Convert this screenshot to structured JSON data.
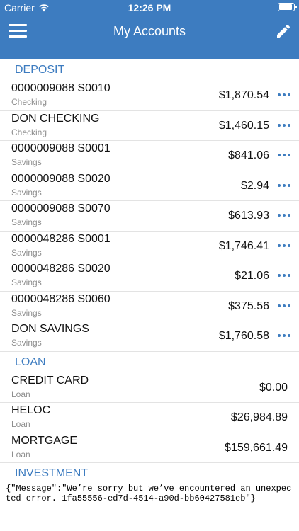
{
  "status_bar": {
    "carrier": "Carrier",
    "time": "12:26 PM",
    "battery_level": 0.95,
    "wifi_icon": "wifi-icon",
    "battery_icon": "battery-icon"
  },
  "header": {
    "title": "My Accounts",
    "menu_icon": "hamburger-menu-icon",
    "edit_icon": "pencil-icon",
    "background": "#3d7cc0"
  },
  "colors": {
    "accent": "#3d7cc0",
    "subtext": "#8e8e8e"
  },
  "sections": [
    {
      "title": "DEPOSIT",
      "accounts": [
        {
          "name": "0000009088 S0010",
          "type": "Checking",
          "balance": "$1,870.54",
          "has_more": true
        },
        {
          "name": "DON CHECKING",
          "type": "Checking",
          "balance": "$1,460.15",
          "has_more": true
        },
        {
          "name": "0000009088 S0001",
          "type": "Savings",
          "balance": "$841.06",
          "has_more": true
        },
        {
          "name": "0000009088 S0020",
          "type": "Savings",
          "balance": "$2.94",
          "has_more": true
        },
        {
          "name": "0000009088 S0070",
          "type": "Savings",
          "balance": "$613.93",
          "has_more": true
        },
        {
          "name": "0000048286 S0001",
          "type": "Savings",
          "balance": "$1,746.41",
          "has_more": true
        },
        {
          "name": "0000048286 S0020",
          "type": "Savings",
          "balance": "$21.06",
          "has_more": true
        },
        {
          "name": "0000048286 S0060",
          "type": "Savings",
          "balance": "$375.56",
          "has_more": true
        },
        {
          "name": "DON SAVINGS",
          "type": "Savings",
          "balance": "$1,760.58",
          "has_more": true
        }
      ]
    },
    {
      "title": "LOAN",
      "accounts": [
        {
          "name": "CREDIT CARD",
          "type": "Loan",
          "balance": "$0.00",
          "has_more": false
        },
        {
          "name": "HELOC",
          "type": "Loan",
          "balance": "$26,984.89",
          "has_more": false
        },
        {
          "name": "MORTGAGE",
          "type": "Loan",
          "balance": "$159,661.49",
          "has_more": false
        }
      ]
    },
    {
      "title": "INVESTMENT",
      "accounts": []
    }
  ],
  "error_message": "{\"Message\":\"We’re sorry but we’ve encountered an unexpected error. 1fa55556-ed7d-4514-a90d-bb60427581eb\"}"
}
